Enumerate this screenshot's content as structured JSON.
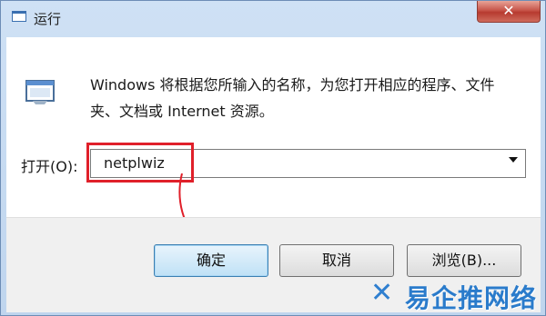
{
  "window": {
    "title": "运行",
    "close_label": "✕"
  },
  "dialog": {
    "description": "Windows 将根据您所输入的名称，为您打开相应的程序、文件夹、文档或 Internet 资源。",
    "open_label": "打开(O):",
    "command_value": "netplwiz"
  },
  "buttons": {
    "ok": "确定",
    "cancel": "取消",
    "browse": "浏览(B)..."
  },
  "annotation": {
    "highlight_color": "#e0202a"
  },
  "watermark": {
    "text": "易企推网络"
  }
}
